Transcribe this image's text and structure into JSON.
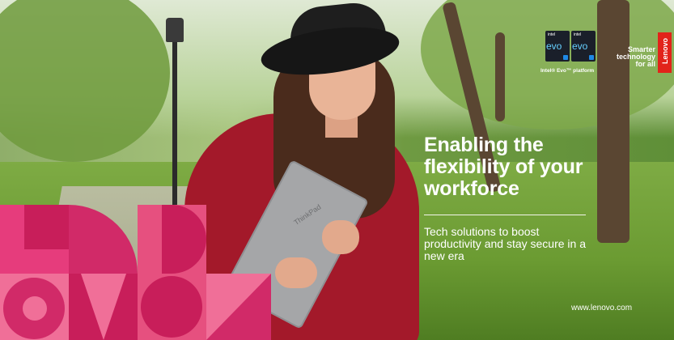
{
  "ad": {
    "headline": "Enabling the flexibility of your workforce",
    "subline": "Tech solutions to boost productivity and stay secure in a new era",
    "url": "www.lenovo.com"
  },
  "badges": {
    "intel_label": "intel",
    "evo_label": "evo",
    "caption": "Intel® Evo™ platform"
  },
  "brand": {
    "tagline": "Smarter technology for all",
    "logo_text": "Lenovo",
    "laptop_logo": "ThinkPad",
    "logo_color": "#e2231a"
  },
  "colors": {
    "pattern_pink": "#e63c7c",
    "pattern_magenta": "#c81e5a",
    "sweater_red": "#a3192a"
  }
}
